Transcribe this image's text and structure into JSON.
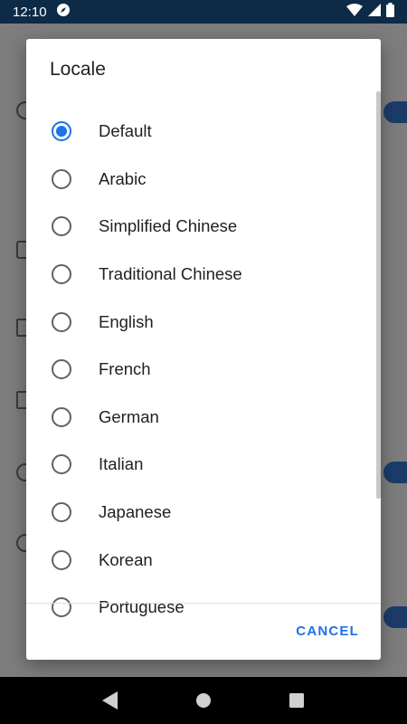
{
  "status_bar": {
    "time": "12:10"
  },
  "dialog": {
    "title": "Locale",
    "options": [
      {
        "label": "Default",
        "selected": true
      },
      {
        "label": "Arabic",
        "selected": false
      },
      {
        "label": "Simplified Chinese",
        "selected": false
      },
      {
        "label": "Traditional Chinese",
        "selected": false
      },
      {
        "label": "English",
        "selected": false
      },
      {
        "label": "French",
        "selected": false
      },
      {
        "label": "German",
        "selected": false
      },
      {
        "label": "Italian",
        "selected": false
      },
      {
        "label": "Japanese",
        "selected": false
      },
      {
        "label": "Korean",
        "selected": false
      },
      {
        "label": "Portuguese",
        "selected": false
      }
    ],
    "cancel_label": "CANCEL"
  },
  "colors": {
    "accent": "#1a73e8",
    "status_bar": "#0d2a47",
    "scrim": "#7d7d7d"
  },
  "icons": {
    "status": [
      "compass-icon",
      "wifi-icon",
      "signal-icon",
      "battery-icon"
    ],
    "nav": [
      "back-icon",
      "home-icon",
      "recents-icon"
    ]
  }
}
